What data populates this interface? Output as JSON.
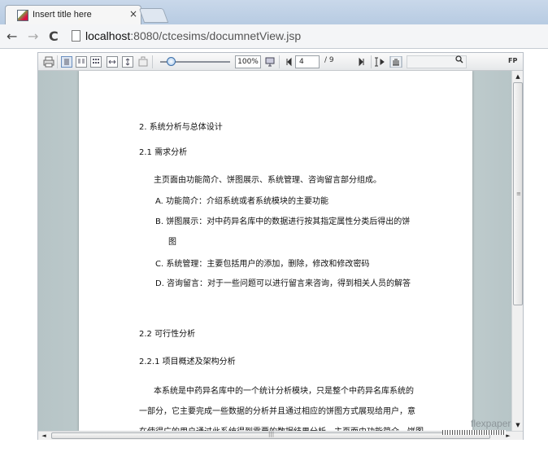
{
  "browser": {
    "tab_title": "Insert title here",
    "tab_close": "×",
    "url_host": "localhost",
    "url_rest": ":8080/ctcesims/documnetView.jsp",
    "back": "←",
    "forward": "→",
    "reload": "C"
  },
  "toolbar": {
    "zoom_value": "100%",
    "page_current": "4",
    "page_total": "/ 9",
    "fp_label": "FP",
    "icons": [
      "print-icon",
      "single-page-icon",
      "two-page-icon",
      "thumbnails-icon",
      "fit-width-icon",
      "fit-page-icon",
      "fullscreen-icon",
      "prev-page-icon",
      "next-page-icon",
      "text-select-icon",
      "hand-tool-icon",
      "search-icon"
    ]
  },
  "document": {
    "lines": [
      "2. 系统分析与总体设计",
      "2.1 需求分析",
      "主页面由功能简介、饼图展示、系统管理、咨询留言部分组成。",
      "A.   功能简介：介绍系统或者系统模块的主要功能",
      "B.   饼图展示：对中药异名库中的数据进行按其指定属性分类后得出的饼",
      "图",
      "C.   系统管理：主要包括用户的添加，删除，修改和修改密码",
      "D.   咨询留言：对于一些问题可以进行留言来咨询，得到相关人员的解答",
      "2.2 可行性分析",
      "2.2.1 项目概述及架构分析",
      "本系统是中药异名库中的一个统计分析模块，只是整个中药异名库系统的",
      "一部分，它主要完成一些数据的分析并且通过相应的饼图方式展现给用户，意",
      "在使得广的用户通过此系统得到需要的数据结果分析，主页面由功能简介、饼图"
    ],
    "watermark": "flexpaper"
  },
  "scrollbar": {
    "up": "▲",
    "down": "▼",
    "left": "◄",
    "right": "►",
    "grip_v": "≡",
    "grip_h": "|||"
  }
}
